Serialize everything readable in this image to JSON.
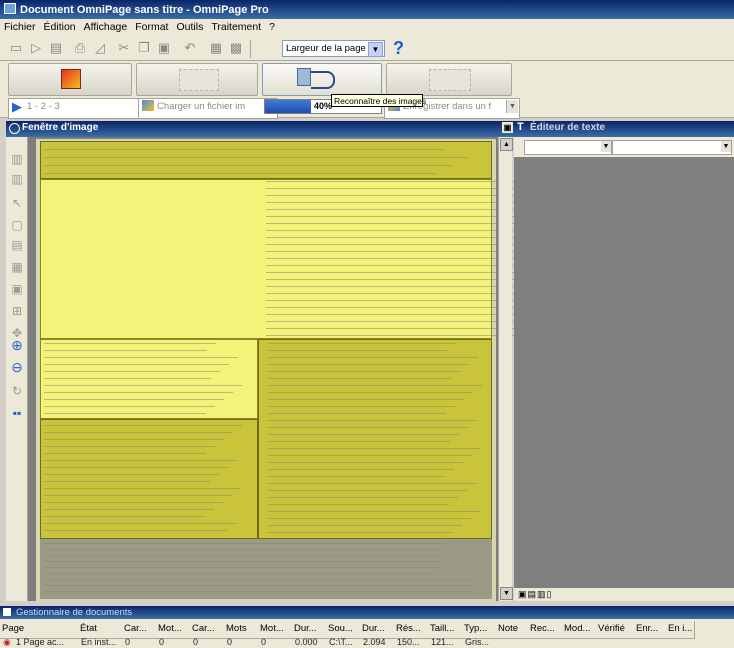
{
  "window": {
    "title": "Document OmniPage sans titre - OmniPage Pro"
  },
  "menu": [
    "Fichier",
    "Édition",
    "Affichage",
    "Format",
    "Outils",
    "Traitement",
    "?"
  ],
  "toolbar": {
    "zoom_value": "Largeur de la page",
    "help_label": "?"
  },
  "steps": {
    "page_selector": "1 - 2 - 3",
    "load_label": "Charger un fichier im",
    "progress_percent": 40,
    "progress_label": "40%",
    "export_label": "Enregistrer dans un f"
  },
  "tooltip": "Reconnaître des images",
  "panels": {
    "image_window_title": "Fenêtre d'image",
    "text_editor_title": "Éditeur de texte",
    "document_manager_title": "Gestionnaire de documents"
  },
  "table": {
    "headers": [
      "Page",
      "État",
      "Car...",
      "Mot...",
      "Car...",
      "Mots",
      "Mot...",
      "Dur...",
      "Sou...",
      "Dur...",
      "Rés...",
      "Taill...",
      "Typ...",
      "Note",
      "Rec...",
      "Mod...",
      "Vérifié",
      "Enr...",
      "En i..."
    ],
    "row": [
      "1 Page ac...",
      "En inst...",
      "0",
      "0",
      "0",
      "0",
      "0",
      "0.000",
      "C:\\T...",
      "2.094",
      "150...",
      "121...",
      "Gris..."
    ]
  },
  "colors": {
    "titlebar": "#0a246a",
    "zone_yellow": "#f5f27a",
    "zone_olive": "#c9c43a",
    "canvas_gray": "#7d7d7d"
  }
}
